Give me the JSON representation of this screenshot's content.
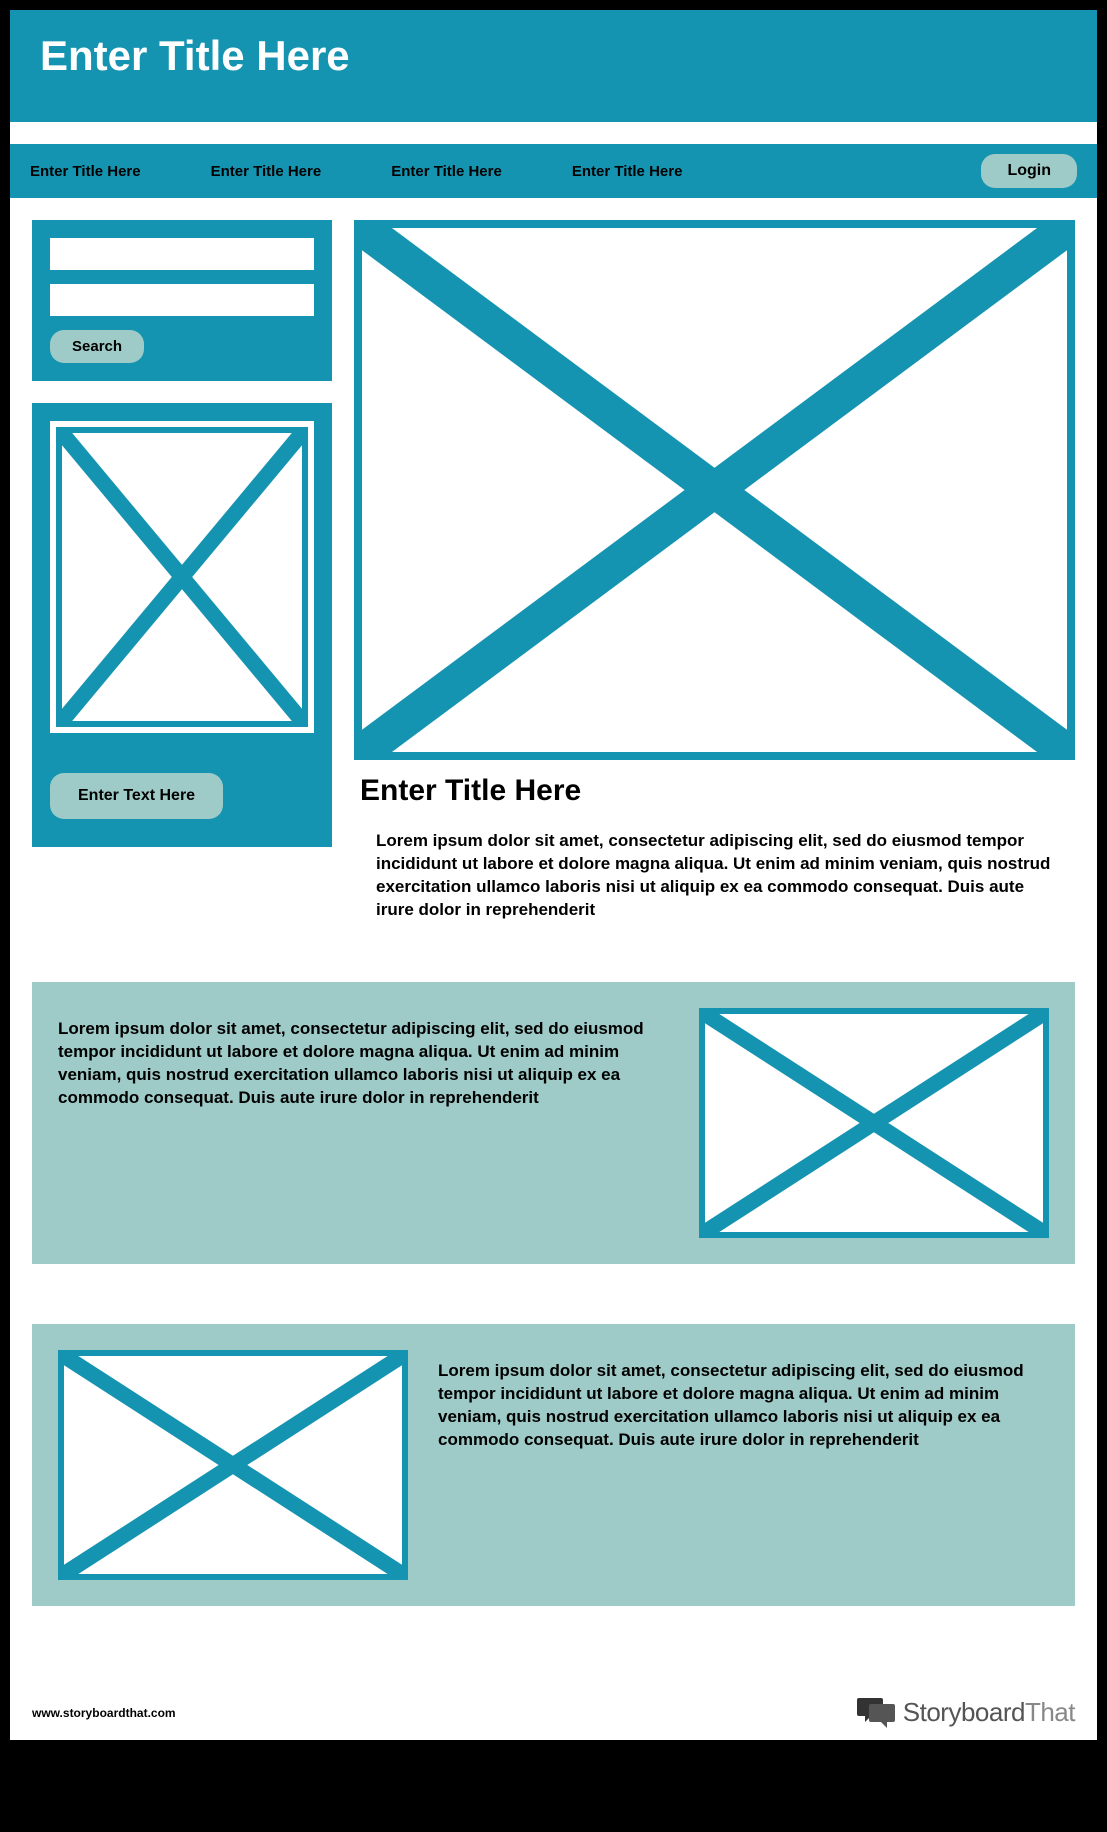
{
  "header": {
    "title": "Enter Title Here"
  },
  "nav": {
    "items": [
      "Enter Title Here",
      "Enter Title Here",
      "Enter Title Here",
      "Enter Title Here"
    ],
    "login": "Login"
  },
  "sidebar": {
    "searchButton": "Search",
    "ctaButton": "Enter Text Here"
  },
  "main": {
    "title": "Enter Title Here",
    "body": "Lorem ipsum dolor sit amet, consectetur adipiscing elit, sed do eiusmod tempor incididunt ut labore et dolore magna aliqua. Ut enim ad minim veniam, quis nostrud exercitation ullamco laboris nisi ut aliquip ex ea commodo consequat. Duis aute irure dolor in reprehenderit"
  },
  "band1": {
    "body": "Lorem ipsum dolor sit amet, consectetur adipiscing elit, sed do eiusmod tempor incididunt ut labore et dolore magna aliqua. Ut enim ad minim veniam, quis nostrud exercitation ullamco laboris nisi ut aliquip ex ea commodo consequat. Duis aute irure dolor in reprehenderit"
  },
  "band2": {
    "body": "Lorem ipsum dolor sit amet, consectetur adipiscing elit, sed do eiusmod tempor incididunt ut labore et dolore magna aliqua. Ut enim ad minim veniam, quis nostrud exercitation ullamco laboris nisi ut aliquip ex ea commodo consequat. Duis aute irure dolor in reprehenderit"
  },
  "footer": {
    "url": "www.storyboardthat.com",
    "brandA": "Storyboard",
    "brandB": "That"
  }
}
